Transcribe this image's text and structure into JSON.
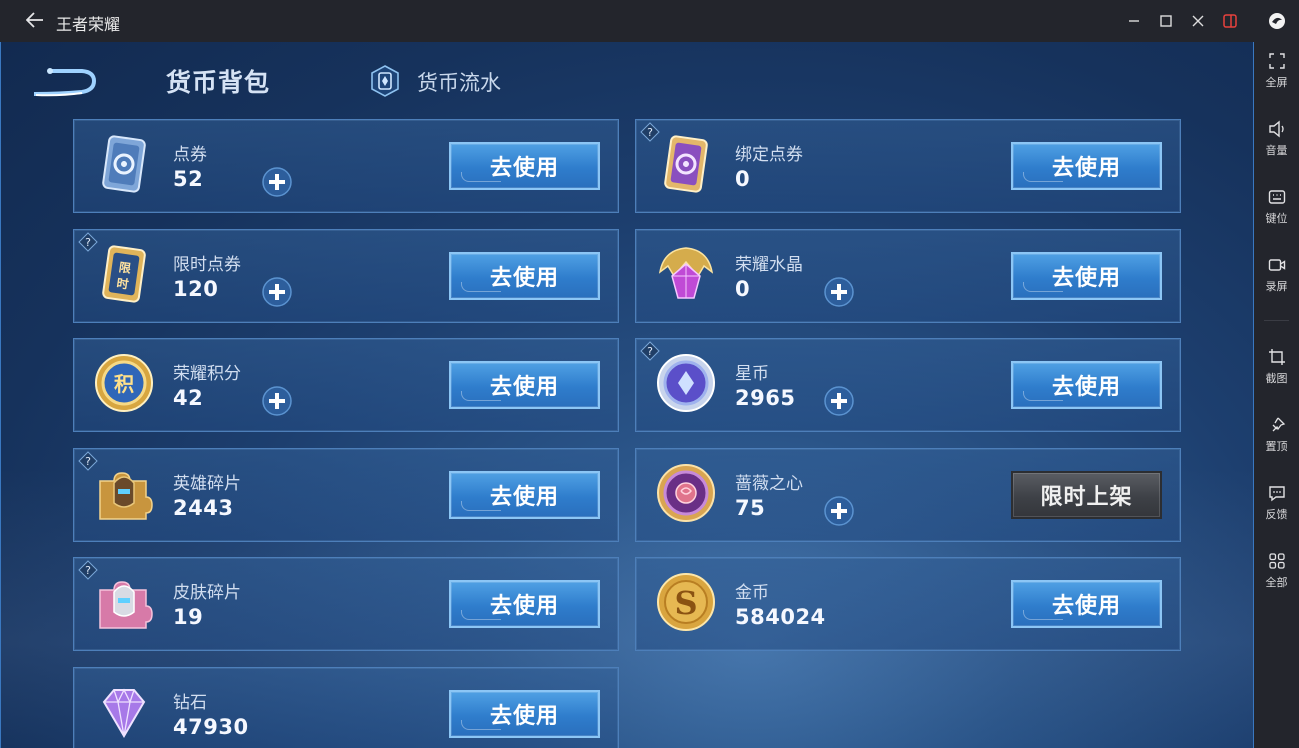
{
  "window": {
    "title": "王者荣耀"
  },
  "sidebar": {
    "items": [
      {
        "label": "全屏",
        "icon": "fullscreen-icon"
      },
      {
        "label": "音量",
        "icon": "volume-icon"
      },
      {
        "label": "键位",
        "icon": "keyboard-icon"
      },
      {
        "label": "录屏",
        "icon": "record-icon"
      },
      {
        "label": "截图",
        "icon": "crop-icon"
      },
      {
        "label": "置顶",
        "icon": "pin-icon"
      },
      {
        "label": "反馈",
        "icon": "feedback-icon"
      },
      {
        "label": "全部",
        "icon": "grid-icon"
      }
    ]
  },
  "header": {
    "title": "货币背包",
    "flow_label": "货币流水"
  },
  "currencies": [
    {
      "name": "点券",
      "value": "52",
      "button": "去使用",
      "icon": "ticket-blue-icon",
      "help": false,
      "plus": true
    },
    {
      "name": "绑定点券",
      "value": "0",
      "button": "去使用",
      "icon": "ticket-purple-icon",
      "help": true,
      "plus": false
    },
    {
      "name": "限时点券",
      "value": "120",
      "button": "去使用",
      "icon": "limited-ticket-icon",
      "help": true,
      "plus": true
    },
    {
      "name": "荣耀水晶",
      "value": "0",
      "button": "去使用",
      "icon": "glory-crystal-icon",
      "help": false,
      "plus": true
    },
    {
      "name": "荣耀积分",
      "value": "42",
      "button": "去使用",
      "icon": "glory-points-icon",
      "help": false,
      "plus": true
    },
    {
      "name": "星币",
      "value": "2965",
      "button": "去使用",
      "icon": "star-coin-icon",
      "help": true,
      "plus": true
    },
    {
      "name": "英雄碎片",
      "value": "2443",
      "button": "去使用",
      "icon": "hero-fragment-icon",
      "help": true,
      "plus": false
    },
    {
      "name": "蔷薇之心",
      "value": "75",
      "button": "限时上架",
      "icon": "rose-heart-icon",
      "help": false,
      "plus": true
    },
    {
      "name": "皮肤碎片",
      "value": "19",
      "button": "去使用",
      "icon": "skin-fragment-icon",
      "help": true,
      "plus": false
    },
    {
      "name": "金币",
      "value": "584024",
      "button": "去使用",
      "icon": "gold-coin-icon",
      "help": false,
      "plus": false
    },
    {
      "name": "钻石",
      "value": "47930",
      "button": "去使用",
      "icon": "diamond-icon",
      "help": false,
      "plus": false
    }
  ],
  "colors": {
    "use_button": "#3a8ad6",
    "limited_button": "#45484e",
    "card_border": "#4d7fba",
    "background": "#1d3f6f"
  }
}
